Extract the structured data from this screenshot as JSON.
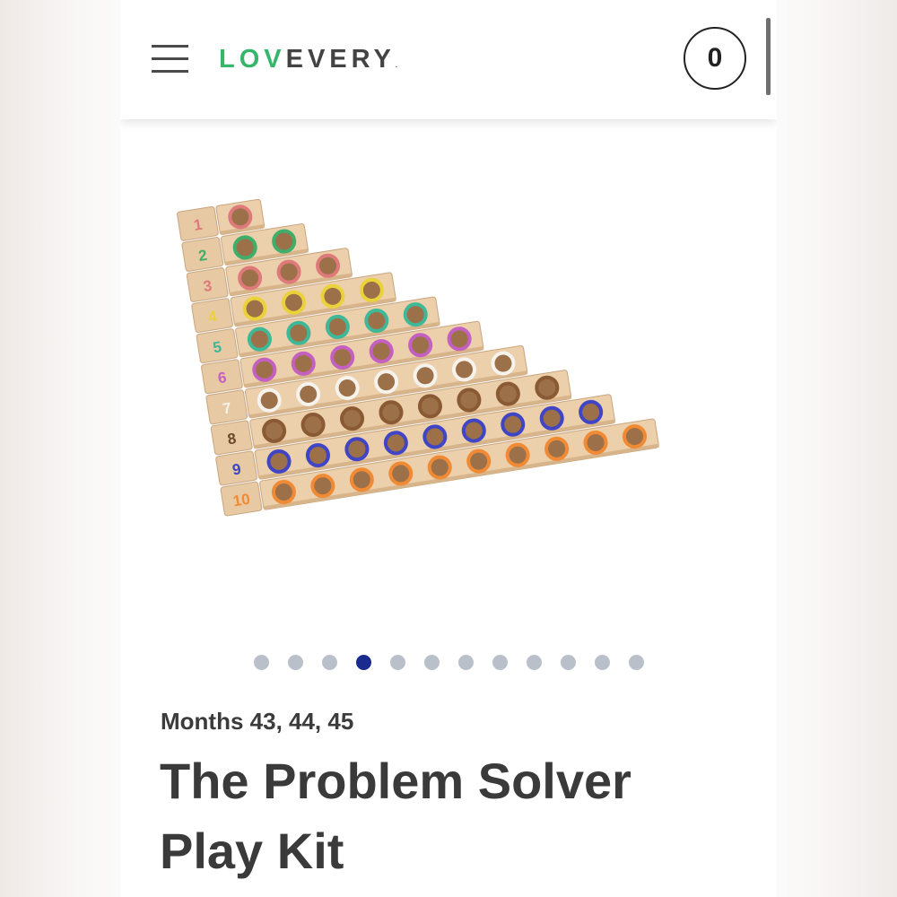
{
  "header": {
    "logo_part1": "LOV",
    "logo_part2": "EVERY",
    "logo_mark": ".",
    "cart_count": "0"
  },
  "product": {
    "image_icon": "wooden-number-rod-counting-board",
    "ring_colors": [
      "#de7a7a",
      "#3fae6a",
      "#de7a7a",
      "#ead23a",
      "#3fb898",
      "#c460c2",
      "#f6f2ec",
      "#8a5a34",
      "#3f45c4",
      "#f08a34"
    ],
    "number_colors": [
      "#de7a7a",
      "#3fae6a",
      "#de7a7a",
      "#ead23a",
      "#3fb898",
      "#c460c2",
      "#f6f2ec",
      "#6b4a2c",
      "#3f45c4",
      "#f08a34"
    ],
    "block_numbers": [
      "1",
      "2",
      "3",
      "4",
      "5",
      "6",
      "7",
      "8",
      "9",
      "10"
    ],
    "carousel": {
      "total": 12,
      "active_index": 3
    },
    "months": "Months 43, 44, 45",
    "title": "The Problem Solver Play Kit"
  },
  "colors": {
    "logo_green": "#35b66b",
    "active_dot": "#1b2a8f",
    "inactive_dot": "#b9c0c9"
  }
}
